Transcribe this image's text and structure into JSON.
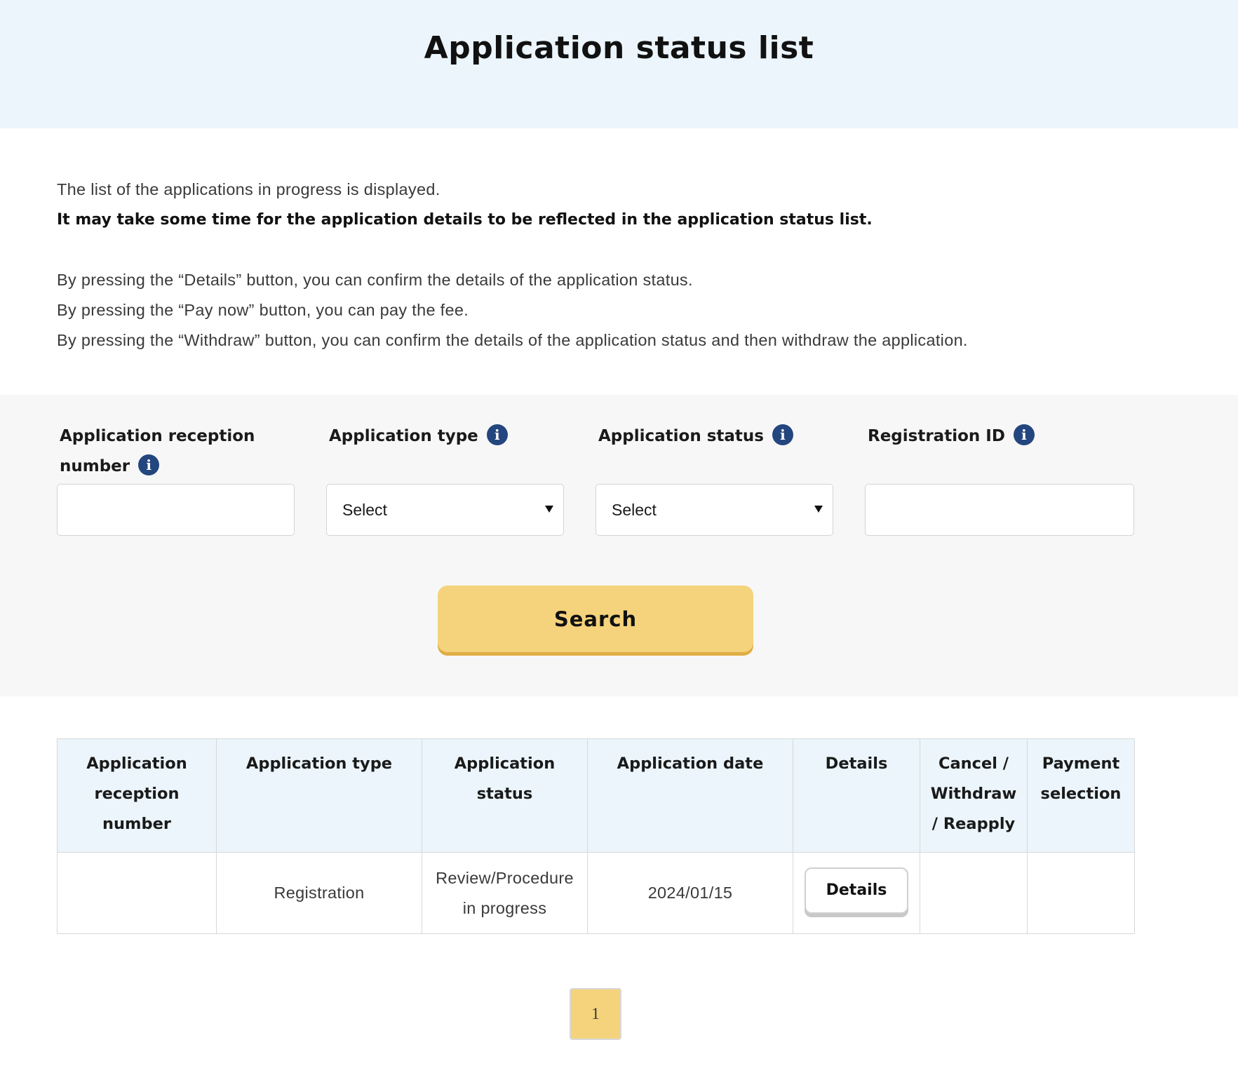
{
  "header": {
    "title": "Application status list"
  },
  "intro": {
    "line1": "The list of the applications in progress is displayed.",
    "line2_bold": "It may take some time for the application details to be reflected in the application status list.",
    "line3": "By pressing the “Details” button, you can confirm the details of the application status.",
    "line4": "By pressing the “Pay now” button, you can pay the fee.",
    "line5": "By pressing the “Withdraw” button, you can confirm the details of the application status and then withdraw the application."
  },
  "search": {
    "reception_number": {
      "label_line1": "Application reception",
      "label_line2": "number",
      "value": "",
      "placeholder": ""
    },
    "application_type": {
      "label": "Application type",
      "selected": "Select"
    },
    "application_status": {
      "label": "Application status",
      "selected": "Select"
    },
    "registration_id": {
      "label": "Registration ID",
      "value": "",
      "placeholder": ""
    },
    "info_icon_glyph": "i",
    "search_label": "Search"
  },
  "table": {
    "headers": [
      "Application reception number",
      "Application type",
      "Application status",
      "Application date",
      "Details",
      "Cancel / Withdraw / Reapply",
      "Payment selection"
    ],
    "rows": [
      {
        "reception_number": "",
        "type": "Registration",
        "status": "Review/Procedure in progress",
        "date": "2024/01/15",
        "details_label": "Details",
        "cancel_withdraw": "",
        "payment": ""
      }
    ]
  },
  "pagination": {
    "current_page": "1"
  },
  "colors": {
    "header_bg": "#ebf5fb",
    "panel_bg": "#f7f7f7",
    "accent_yellow": "#f5d37c",
    "info_icon": "#24467f"
  }
}
